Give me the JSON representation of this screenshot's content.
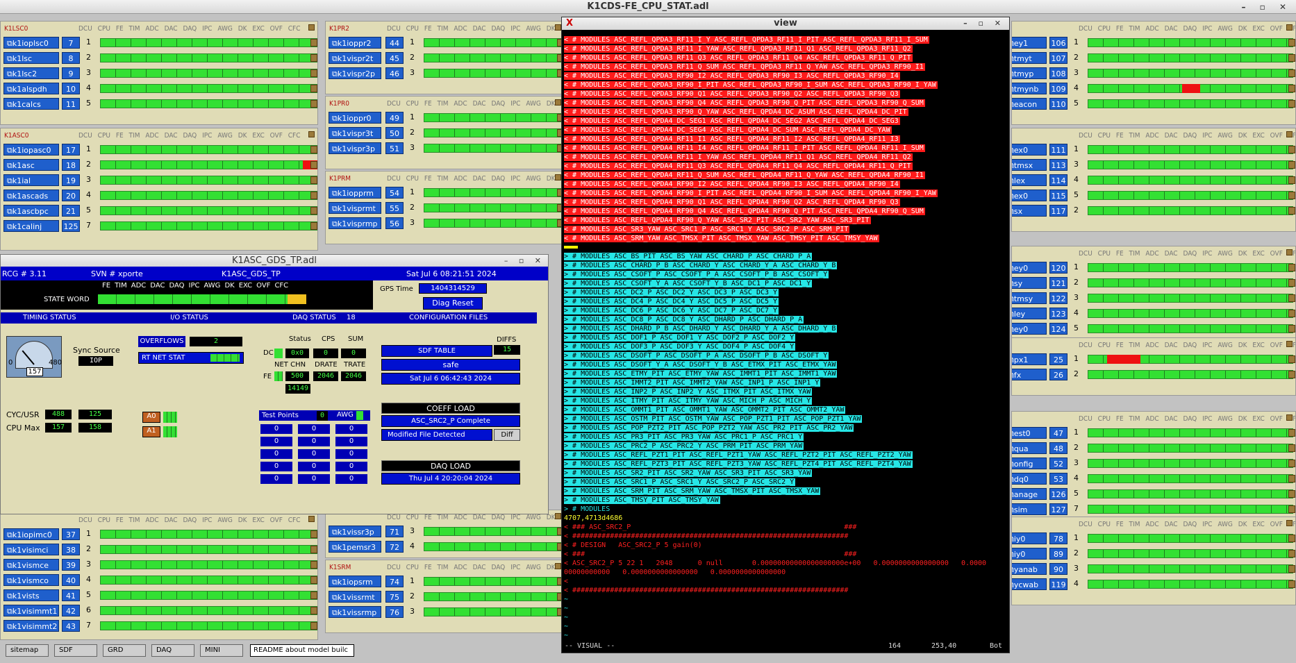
{
  "window": {
    "title": "K1CDS-FE_CPU_STAT.adl"
  },
  "columns": [
    "DCU",
    "CPU",
    "FE",
    "TIM",
    "ADC",
    "DAC",
    "DAQ",
    "IPC",
    "AWG",
    "DK",
    "EXC",
    "OVF",
    "CFC"
  ],
  "left_panels": [
    {
      "name": "K1LSC0",
      "rows": [
        {
          "model": "k1ioplsc0",
          "dcu": "7",
          "cpu": "1"
        },
        {
          "model": "k1lsc",
          "dcu": "8",
          "cpu": "2"
        },
        {
          "model": "k1lsc2",
          "dcu": "9",
          "cpu": "3"
        },
        {
          "model": "k1alspdh",
          "dcu": "10",
          "cpu": "4"
        },
        {
          "model": "k1calcs",
          "dcu": "11",
          "cpu": "5"
        }
      ]
    },
    {
      "name": "K1ASC0",
      "rows": [
        {
          "model": "k1iopasc0",
          "dcu": "17",
          "cpu": "1"
        },
        {
          "model": "k1asc",
          "dcu": "18",
          "cpu": "2"
        },
        {
          "model": "k1ial",
          "dcu": "19",
          "cpu": "3"
        },
        {
          "model": "k1ascads",
          "dcu": "20",
          "cpu": "4"
        },
        {
          "model": "k1ascbpc",
          "dcu": "21",
          "cpu": "5"
        },
        {
          "model": "k1calinj",
          "dcu": "125",
          "cpu": "7"
        }
      ]
    },
    {
      "name": "",
      "rows": [
        {
          "model": "k1iopimc0",
          "dcu": "37",
          "cpu": "1"
        },
        {
          "model": "k1visimci",
          "dcu": "38",
          "cpu": "2"
        },
        {
          "model": "k1vismce",
          "dcu": "39",
          "cpu": "3"
        },
        {
          "model": "k1vismco",
          "dcu": "40",
          "cpu": "4"
        },
        {
          "model": "k1vists",
          "dcu": "41",
          "cpu": "5"
        },
        {
          "model": "k1visimmt1",
          "dcu": "42",
          "cpu": "6"
        },
        {
          "model": "k1visimmt2",
          "dcu": "43",
          "cpu": "7"
        }
      ]
    }
  ],
  "mid_panels": [
    {
      "name": "K1PR2",
      "rows": [
        {
          "model": "k1ioppr2",
          "dcu": "44",
          "cpu": "1"
        },
        {
          "model": "k1vispr2t",
          "dcu": "45",
          "cpu": "2"
        },
        {
          "model": "k1vispr2p",
          "dcu": "46",
          "cpu": "3"
        }
      ]
    },
    {
      "name": "K1PR0",
      "rows": [
        {
          "model": "k1ioppr0",
          "dcu": "49",
          "cpu": "1"
        },
        {
          "model": "k1vispr3t",
          "dcu": "50",
          "cpu": "2"
        },
        {
          "model": "k1vispr3p",
          "dcu": "51",
          "cpu": "3"
        }
      ]
    },
    {
      "name": "K1PRM",
      "rows": [
        {
          "model": "k1iopprm",
          "dcu": "54",
          "cpu": "1"
        },
        {
          "model": "k1visprmt",
          "dcu": "55",
          "cpu": "2"
        },
        {
          "model": "k1visprmp",
          "dcu": "56",
          "cpu": "3"
        }
      ]
    },
    {
      "name": "",
      "rows": [
        {
          "model": "k1vissr3p",
          "dcu": "71",
          "cpu": "3"
        },
        {
          "model": "k1pemsr3",
          "dcu": "72",
          "cpu": "4"
        }
      ]
    },
    {
      "name": "K1SRM",
      "rows": [
        {
          "model": "k1iopsrm",
          "dcu": "74",
          "cpu": "1"
        },
        {
          "model": "k1vissrmt",
          "dcu": "75",
          "cpu": "2"
        },
        {
          "model": "k1vissrmp",
          "dcu": "76",
          "cpu": "3"
        }
      ]
    }
  ],
  "right_panels": [
    {
      "rows": [
        {
          "model": "ey1",
          "dcu": "106",
          "cpu": "1"
        },
        {
          "model": "tmyt",
          "dcu": "107",
          "cpu": "2"
        },
        {
          "model": "tmyp",
          "dcu": "108",
          "cpu": "3"
        },
        {
          "model": "tmynb",
          "dcu": "109",
          "cpu": "4"
        },
        {
          "model": "eacon",
          "dcu": "110",
          "cpu": "5"
        }
      ]
    },
    {
      "rows": [
        {
          "model": "ex0",
          "dcu": "111",
          "cpu": "1"
        },
        {
          "model": "tmsx",
          "dcu": "113",
          "cpu": "3"
        },
        {
          "model": "lex",
          "dcu": "114",
          "cpu": "4"
        },
        {
          "model": "ex0",
          "dcu": "115",
          "cpu": "5"
        },
        {
          "model": "sx",
          "dcu": "117",
          "cpu": "2"
        }
      ]
    },
    {
      "rows": [
        {
          "model": "ey0",
          "dcu": "120",
          "cpu": "1"
        },
        {
          "model": "sy",
          "dcu": "121",
          "cpu": "2"
        },
        {
          "model": "tmsy",
          "dcu": "122",
          "cpu": "3"
        },
        {
          "model": "ley",
          "dcu": "123",
          "cpu": "4"
        },
        {
          "model": "ey0",
          "dcu": "124",
          "cpu": "5"
        }
      ]
    },
    {
      "rows": [
        {
          "model": "px1",
          "dcu": "25",
          "cpu": "1"
        },
        {
          "model": "fx",
          "dcu": "26",
          "cpu": "2"
        }
      ]
    },
    {
      "rows": [
        {
          "model": "est0",
          "dcu": "47",
          "cpu": "1"
        },
        {
          "model": "qua",
          "dcu": "48",
          "cpu": "2"
        },
        {
          "model": "onfig",
          "dcu": "52",
          "cpu": "3"
        },
        {
          "model": "dq0",
          "dcu": "53",
          "cpu": "4"
        },
        {
          "model": "anage",
          "dcu": "126",
          "cpu": "5"
        },
        {
          "model": "sim",
          "dcu": "127",
          "cpu": "7"
        }
      ]
    },
    {
      "rows": [
        {
          "model": "iy0",
          "dcu": "78",
          "cpu": "1"
        },
        {
          "model": "iy0",
          "dcu": "89",
          "cpu": "2"
        },
        {
          "model": "yanab",
          "dcu": "90",
          "cpu": "3"
        },
        {
          "model": "ycwab",
          "dcu": "119",
          "cpu": "4"
        }
      ]
    }
  ],
  "bottom": {
    "buttons": [
      "sitemap",
      "SDF",
      "GRD",
      "DAQ",
      "MINI"
    ],
    "readme": "README about model builc"
  },
  "gds": {
    "title": "K1ASC_GDS_TP.adl",
    "rcg": "RCG #   3.11",
    "svn": "SVN # xporte",
    "model": "K1ASC_GDS_TP",
    "date": "Sat Jul  6 08:21:51 2024",
    "state_word": "STATE WORD",
    "state_cols": [
      "FE",
      "TIM",
      "ADC",
      "DAC",
      "DAQ",
      "IPC",
      "AWG",
      "DK",
      "EXC",
      "OVF",
      "CFC"
    ],
    "gps_label": "GPS Time",
    "gps": "1404314529",
    "diag_reset": "Diag Reset",
    "sections": [
      "TIMING STATUS",
      "I/O STATUS",
      "DAQ STATUS",
      "18",
      "CONFIGURATION FILES"
    ],
    "sync_source": "Sync Source",
    "sync_val": "IOP",
    "gauge_min": "0",
    "gauge_val": "157",
    "gauge_max": "480",
    "cyc_label": "CYC/USR",
    "cyc_a": "488",
    "cyc_b": "125",
    "cpumax_label": "CPU Max",
    "cpumax_a": "157",
    "cpumax_b": "158",
    "overflows": "OVERFLOWS",
    "overflows_val": "2",
    "rtnet": "RT NET STAT",
    "a0": "A0",
    "a1": "A1",
    "daq_status": "Status",
    "daq_cps": "CPS",
    "daq_sum": "SUM",
    "dc": "DC",
    "dc_val": "0x0",
    "cps_val": "0",
    "sum_val": "0",
    "net_chn": "NET CHN",
    "drate": "DRATE",
    "trate": "TRATE",
    "fe": "FE",
    "chn_val": "500",
    "drate_val": "2046",
    "trate_val": "2046",
    "net_val": "14149",
    "test_points": "Test Points",
    "tp_val": "0",
    "awg": "AWG",
    "tp_grid": [
      "0",
      "0",
      "0",
      "0",
      "0",
      "0",
      "0",
      "0",
      "0",
      "0",
      "0",
      "0",
      "0",
      "0",
      "0"
    ],
    "sdf_table": "SDF TABLE",
    "diffs": "DIFFS",
    "diffs_val": "15",
    "safe": "safe",
    "sdf_date": "Sat Jul  6 06:42:43 2024",
    "coeff_load": "COEFF LOAD",
    "coeff_status": "ASC_SRC2_P Complete",
    "modified": "Modified File Detected",
    "diff_btn": "Diff",
    "daq_load": "DAQ LOAD",
    "daq_date": "Thu Jul  4 20:20:04 2024"
  },
  "view": {
    "title": "view",
    "red_lines": [
      "< # MODULES ASC_REFL_QPDA3_RF11_I_Y ASC_REFL_QPDA3_RF11_I_PIT ASC_REFL_QPDA3_RF11_I_SUM",
      "< # MODULES ASC_REFL_QPDA3_RF11_I_YAW ASC_REFL_QPDA3_RF11_Q1 ASC_REFL_QPDA3_RF11_Q2",
      "< # MODULES ASC_REFL_QPDA3_RF11_Q3 ASC_REFL_QPDA3_RF11_Q4 ASC_REFL_QPDA3_RF11_Q_PIT",
      "< # MODULES ASC_REFL_QPDA3_RF11_Q_SUM ASC_REFL_QPDA3_RF11_Q_YAW ASC_REFL_QPDA3_RF90_I1",
      "< # MODULES ASC_REFL_QPDA3_RF90_I2 ASC_REFL_QPDA3_RF90_I3 ASC_REFL_QPDA3_RF90_I4",
      "< # MODULES ASC_REFL_QPDA3_RF90_I_PIT ASC_REFL_QPDA3_RF90_I_SUM ASC_REFL_QPDA3_RF90_I_YAW",
      "< # MODULES ASC_REFL_QPDA3_RF90_Q1 ASC_REFL_QPDA3_RF90_Q2 ASC_REFL_QPDA3_RF90_Q3",
      "< # MODULES ASC_REFL_QPDA3_RF90_Q4 ASC_REFL_QPDA3_RF90_Q_PIT ASC_REFL_QPDA3_RF90_Q_SUM",
      "< # MODULES ASC_REFL_QPDA3_RF90_Q_YAW ASC_REFL_QPDA4_DC_ASUM ASC_REFL_QPDA4_DC_PIT",
      "< # MODULES ASC_REFL_QPDA4_DC_SEG1 ASC_REFL_QPDA4_DC_SEG2 ASC_REFL_QPDA4_DC_SEG3",
      "< # MODULES ASC_REFL_QPDA4_DC_SEG4 ASC_REFL_QPDA4_DC_SUM ASC_REFL_QPDA4_DC_YAW",
      "< # MODULES ASC_REFL_QPDA4_RF11_I1 ASC_REFL_QPDA4_RF11_I2 ASC_REFL_QPDA4_RF11_I3",
      "< # MODULES ASC_REFL_QPDA4_RF11_I4 ASC_REFL_QPDA4_RF11_I_PIT ASC_REFL_QPDA4_RF11_I_SUM",
      "< # MODULES ASC_REFL_QPDA4_RF11_I_YAW ASC_REFL_QPDA4_RF11_Q1 ASC_REFL_QPDA4_RF11_Q2",
      "< # MODULES ASC_REFL_QPDA4_RF11_Q3 ASC_REFL_QPDA4_RF11_Q4 ASC_REFL_QPDA4_RF11_Q_PIT",
      "< # MODULES ASC_REFL_QPDA4_RF11_Q_SUM ASC_REFL_QPDA4_RF11_Q_YAW ASC_REFL_QPDA4_RF90_I1",
      "< # MODULES ASC_REFL_QPDA4_RF90_I2 ASC_REFL_QPDA4_RF90_I3 ASC_REFL_QPDA4_RF90_I4",
      "< # MODULES ASC_REFL_QPDA4_RF90_I_PIT ASC_REFL_QPDA4_RF90_I_SUM ASC_REFL_QPDA4_RF90_I_YAW",
      "< # MODULES ASC_REFL_QPDA4_RF90_Q1 ASC_REFL_QPDA4_RF90_Q2 ASC_REFL_QPDA4_RF90_Q3",
      "< # MODULES ASC_REFL_QPDA4_RF90_Q4 ASC_REFL_QPDA4_RF90_Q_PIT ASC_REFL_QPDA4_RF90_Q_SUM",
      "< # MODULES ASC_REFL_QPDA4_RF90_Q_YAW ASC_SR2_PIT ASC_SR2_YAW ASC_SR3_PIT",
      "< # MODULES ASC_SR3_YAW ASC_SRC1_P ASC_SRC1_Y ASC_SRC2_P ASC_SRM_PIT",
      "< # MODULES ASC_SRM_YAW ASC_TMSX_PIT ASC_TMSX_YAW ASC_TMSY_PIT ASC_TMSY_YAW"
    ],
    "cyan_lines": [
      "> # MODULES ASC_BS_PIT ASC_BS_YAW ASC_CHARD_P ASC_CHARD_P_A",
      "> # MODULES ASC_CHARD_P_B ASC_CHARD_Y ASC_CHARD_Y_A ASC_CHARD_Y_B",
      "> # MODULES ASC_CSOFT_P ASC_CSOFT_P_A ASC_CSOFT_P_B ASC_CSOFT_Y",
      "> # MODULES ASC_CSOFT_Y_A ASC_CSOFT_Y_B ASC_DC1_P ASC_DC1_Y",
      "> # MODULES ASC_DC2_P ASC_DC2_Y ASC_DC3_P ASC_DC3_Y",
      "> # MODULES ASC_DC4_P ASC_DC4_Y ASC_DC5_P ASC_DC5_Y",
      "> # MODULES ASC_DC6_P ASC_DC6_Y ASC_DC7_P ASC_DC7_Y",
      "> # MODULES ASC_DC8_P ASC_DC8_Y ASC_DHARD_P ASC_DHARD_P_A",
      "> # MODULES ASC_DHARD_P_B ASC_DHARD_Y ASC_DHARD_Y_A ASC_DHARD_Y_B",
      "> # MODULES ASC_DOF1_P ASC_DOF1_Y ASC_DOF2_P ASC_DOF2_Y",
      "> # MODULES ASC_DOF3_P ASC_DOF3_Y ASC_DOF4_P ASC_DOF4_Y",
      "> # MODULES ASC_DSOFT_P ASC_DSOFT_P_A ASC_DSOFT_P_B ASC_DSOFT_Y",
      "> # MODULES ASC_DSOFT_Y_A ASC_DSOFT_Y_B ASC_ETMX_PIT ASC_ETMX_YAW",
      "> # MODULES ASC_ETMY_PIT ASC_ETMY_YAW ASC_IMMT1_PIT ASC_IMMT1_YAW",
      "> # MODULES ASC_IMMT2_PIT ASC_IMMT2_YAW ASC_INP1_P ASC_INP1_Y",
      "> # MODULES ASC_INP2_P ASC_INP2_Y ASC_ITMX_PIT ASC_ITMX_YAW",
      "> # MODULES ASC_ITMY_PIT ASC_ITMY_YAW ASC_MICH_P ASC_MICH_Y",
      "> # MODULES ASC_OMMT1_PIT ASC_OMMT1_YAW ASC_OMMT2_PIT ASC_OMMT2_YAW",
      "> # MODULES ASC_OSTM_PIT ASC_OSTM_YAW ASC_POP_PZT1_PIT ASC_POP_PZT1_YAW",
      "> # MODULES ASC_POP_PZT2_PIT ASC_POP_PZT2_YAW ASC_PR2_PIT ASC_PR2_YAW",
      "> # MODULES ASC_PR3_PIT ASC_PR3_YAW ASC_PRC1_P ASC_PRC1_Y",
      "> # MODULES ASC_PRC2_P ASC_PRC2_Y ASC_PRM_PIT ASC_PRM_YAW",
      "> # MODULES ASC_REFL_PZT1_PIT ASC_REFL_PZT1_YAW ASC_REFL_PZT2_PIT ASC_REFL_PZT2_YAW",
      "> # MODULES ASC_REFL_PZT3_PIT ASC_REFL_PZT3_YAW ASC_REFL_PZT4_PIT ASC_REFL_PZT4_YAW",
      "> # MODULES ASC_SR2_PIT ASC_SR2_YAW ASC_SR3_PIT ASC_SR3_YAW",
      "> # MODULES ASC_SRC1_P ASC_SRC1_Y ASC_SRC2_P ASC_SRC2_Y",
      "> # MODULES ASC_SRM_PIT ASC_SRM_YAW ASC_TMSX_PIT ASC_TMSX_YAW",
      "> # MODULES ASC_TMSY_PIT ASC_TMSY_YAW"
    ],
    "tail_lines": [
      {
        "t": "> # MODULES",
        "c": "tcy"
      },
      {
        "t": "4707,4713d4686",
        "c": "tyel"
      },
      {
        "t": "< ### ASC_SRC2_P                                                   ###",
        "c": "tred"
      },
      {
        "t": "< ##################################################################",
        "c": "tred"
      },
      {
        "t": "< # DESIGN   ASC_SRC2_P 5 gain(0)",
        "c": "tred"
      },
      {
        "t": "< ###                                                              ###",
        "c": "tred"
      },
      {
        "t": "< ASC_SRC2_P 5 22 1   2048      0 null       0.00000000000000000000e+00   0.0000000000000000   0.0000",
        "c": "tred"
      },
      {
        "t": "00000000000   0.0000000000000000   0.0000000000000000",
        "c": "tred"
      },
      {
        "t": "<",
        "c": "tred"
      },
      {
        "t": "< ##################################################################",
        "c": "tred"
      },
      {
        "t": "~",
        "c": "tcy"
      },
      {
        "t": "~",
        "c": "tcy"
      },
      {
        "t": "~",
        "c": "tcy"
      },
      {
        "t": "~",
        "c": "tcy"
      },
      {
        "t": "~",
        "c": "tcy"
      }
    ],
    "status_mode": "-- VISUAL --",
    "status_count": "164",
    "status_pos": "253,40",
    "status_where": "Bot"
  }
}
